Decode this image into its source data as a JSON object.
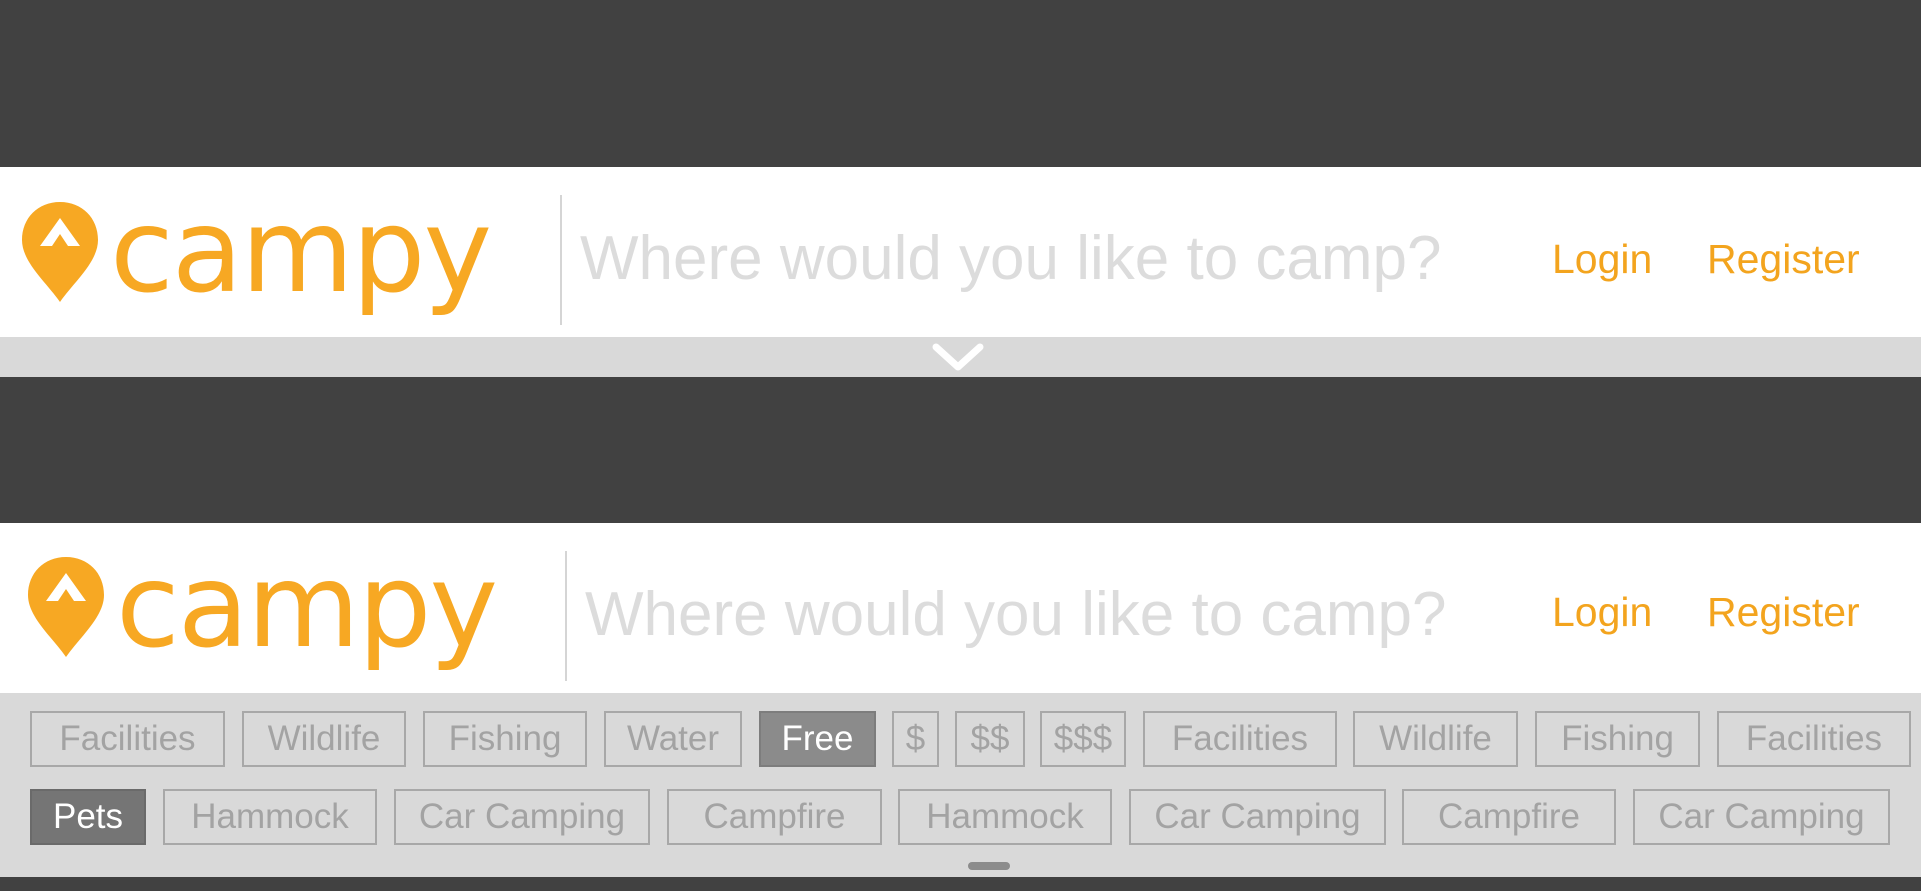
{
  "colors": {
    "accent": "#f7a823",
    "dark_band": "#414141",
    "filter_bg": "#d9d9d9"
  },
  "header_collapsed": {
    "logo_text": "campy",
    "search_placeholder": "Where would you like to camp?",
    "login_label": "Login",
    "register_label": "Register",
    "expand_icon": "chevron-down-icon"
  },
  "header_expanded": {
    "logo_text": "campy",
    "search_placeholder": "Where would you like to camp?",
    "login_label": "Login",
    "register_label": "Register",
    "collapse_icon": "drag-handle-icon"
  },
  "filters": {
    "row1": [
      "Facilities",
      "Wildlife",
      "Fishing",
      "Water",
      "Free",
      "$",
      "$$",
      "$$$",
      "Facilities",
      "Wildlife",
      "Fishing",
      "Facilities"
    ],
    "row2": [
      "Pets",
      "Hammock",
      "Car Camping",
      "Campfire",
      "Hammock",
      "Car Camping",
      "Campfire",
      "Car Camping"
    ],
    "selected": [
      "Free",
      "Pets"
    ]
  }
}
